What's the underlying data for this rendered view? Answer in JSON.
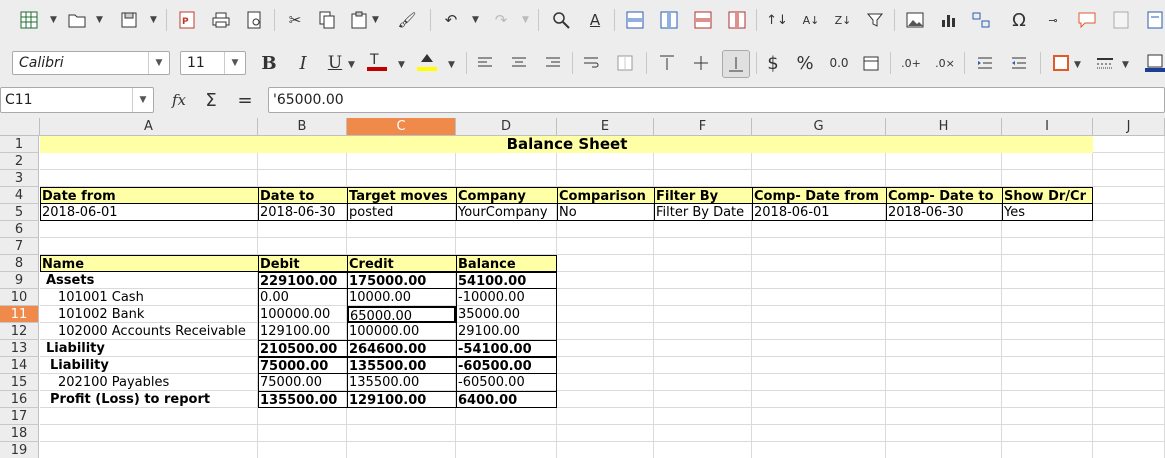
{
  "toolbar2": {
    "font_name": "Calibri",
    "font_size": "11",
    "bold": "B",
    "italic": "I",
    "underline": "U",
    "currency": "$",
    "percent": "%",
    "number_format": "0.0",
    "omega": "Ω"
  },
  "formula_bar": {
    "name_box": "C11",
    "fx": "fx",
    "sigma": "Σ",
    "equals": "=",
    "formula": "'65000.00"
  },
  "columns": [
    {
      "label": "A",
      "selected": false
    },
    {
      "label": "B",
      "selected": false
    },
    {
      "label": "C",
      "selected": true
    },
    {
      "label": "D",
      "selected": false
    },
    {
      "label": "E",
      "selected": false
    },
    {
      "label": "F",
      "selected": false
    },
    {
      "label": "G",
      "selected": false
    },
    {
      "label": "H",
      "selected": false
    },
    {
      "label": "I",
      "selected": false
    },
    {
      "label": "J",
      "selected": false
    }
  ],
  "rows": [
    "1",
    "2",
    "3",
    "4",
    "5",
    "6",
    "7",
    "8",
    "9",
    "10",
    "11",
    "12",
    "13",
    "14",
    "15",
    "16",
    "17",
    "18",
    "19"
  ],
  "selected_row": "11",
  "sheet": {
    "title": "Balance Sheet",
    "filter_headers": [
      "Date from",
      "Date to",
      "Target moves",
      "Company",
      "Comparison",
      "Filter By",
      "Comp- Date from",
      "Comp- Date to",
      "Show Dr/Cr"
    ],
    "filter_values": [
      "2018-06-01",
      "2018-06-30",
      "posted",
      "YourCompany",
      "No",
      "Filter By Date",
      "2018-06-01",
      "2018-06-30",
      "Yes"
    ],
    "table_headers": [
      "Name",
      "Debit",
      "Credit",
      "Balance"
    ],
    "table_rows": [
      {
        "name": "Assets",
        "debit": "229100.00",
        "credit": "175000.00",
        "balance": "54100.00",
        "bold": true
      },
      {
        "name": "101001 Cash",
        "debit": "0.00",
        "credit": "10000.00",
        "balance": "-10000.00",
        "bold": false
      },
      {
        "name": "101002 Bank",
        "debit": "100000.00",
        "credit": "65000.00",
        "balance": "35000.00",
        "bold": false
      },
      {
        "name": "102000 Accounts Receivable",
        "debit": "129100.00",
        "credit": "100000.00",
        "balance": "29100.00",
        "bold": false
      },
      {
        "name": "Liability",
        "debit": "210500.00",
        "credit": "264600.00",
        "balance": "-54100.00",
        "bold": true
      },
      {
        "name": "Liability",
        "debit": "75000.00",
        "credit": "135500.00",
        "balance": "-60500.00",
        "bold": true
      },
      {
        "name": "202100 Payables",
        "debit": "75000.00",
        "credit": "135500.00",
        "balance": "-60500.00",
        "bold": false
      },
      {
        "name": "Profit (Loss) to report",
        "debit": "135500.00",
        "credit": "129100.00",
        "balance": "6400.00",
        "bold": true
      }
    ]
  },
  "colors": {
    "header_fill": "#ffffa6",
    "selection": "#f08a4b",
    "font_color_bar": "#c00000",
    "highlight_bar": "#ffff00"
  }
}
